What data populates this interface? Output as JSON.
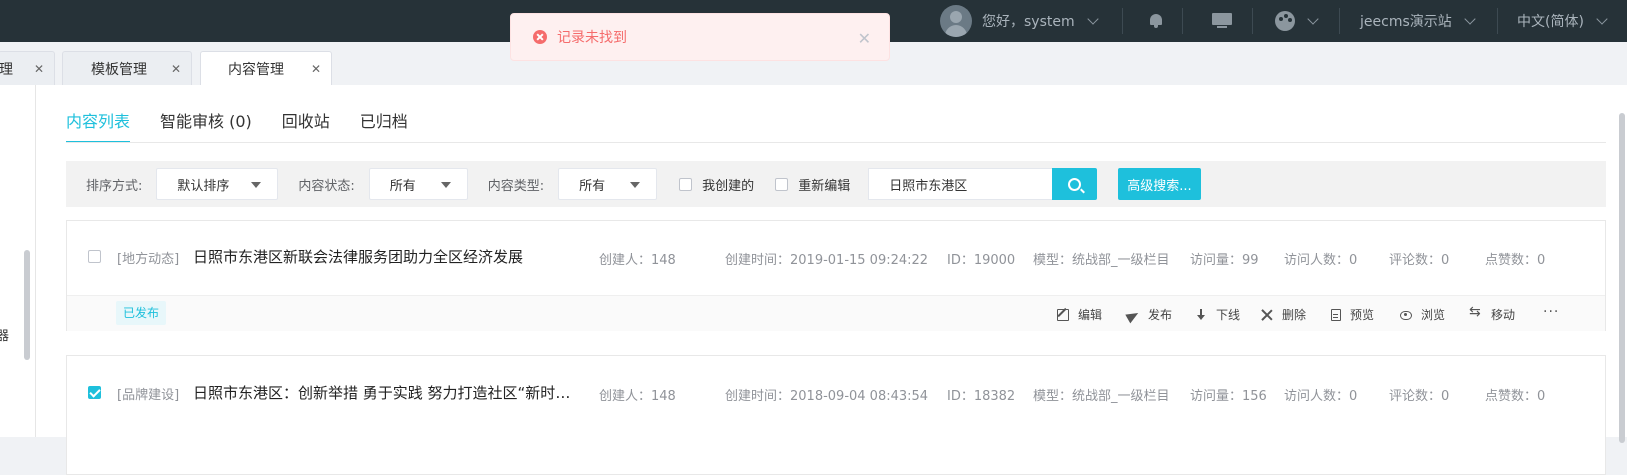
{
  "topbar": {
    "greeting": "您好，system",
    "site": "jeecms演示站",
    "language": "中文(简体)"
  },
  "toast": {
    "message": "记录未找到"
  },
  "tabs": [
    {
      "label": "理"
    },
    {
      "label": "模板管理"
    },
    {
      "label": "内容管理"
    }
  ],
  "subtabs": [
    "内容列表",
    "智能审核 (0)",
    "回收站",
    "已归档"
  ],
  "filter": {
    "sort_label": "排序方式:",
    "sort_value": "默认排序",
    "status_label": "内容状态:",
    "status_value": "所有",
    "type_label": "内容类型:",
    "type_value": "所有",
    "mine_label": "我创建的",
    "reedit_label": "重新编辑",
    "search_value": "日照市东港区",
    "advanced_label": "高级搜索..."
  },
  "sidebar_char": "器",
  "items": [
    {
      "category": "[地方动态]",
      "title": "日照市东港区新联会法律服务团助力全区经济发展",
      "creator": "创建人：148",
      "created": "创建时间：2019-01-15 09:24:22",
      "id": "ID：19000",
      "model": "模型：统战部_一级栏目",
      "visits": "访问量：99",
      "visitors": "访问人数：0",
      "comments": "评论数：0",
      "likes": "点赞数：0",
      "status": "已发布",
      "checked": false
    },
    {
      "category": "[品牌建设]",
      "title": "日照市东港区：创新举措 勇于实践 努力打造社区“新时代文明实践站”",
      "creator": "创建人：148",
      "created": "创建时间：2018-09-04 08:43:54",
      "id": "ID：18382",
      "model": "模型：统战部_一级栏目",
      "visits": "访问量：156",
      "visitors": "访问人数：0",
      "comments": "评论数：0",
      "likes": "点赞数：0",
      "checked": true
    }
  ],
  "actions": {
    "edit": "编辑",
    "publish": "发布",
    "offline": "下线",
    "delete": "删除",
    "preview": "预览",
    "browse": "浏览",
    "move": "移动",
    "more": "···"
  },
  "colors": {
    "accent": "#1ec0dc",
    "topbar": "#263238",
    "error": "#f56c6c"
  }
}
